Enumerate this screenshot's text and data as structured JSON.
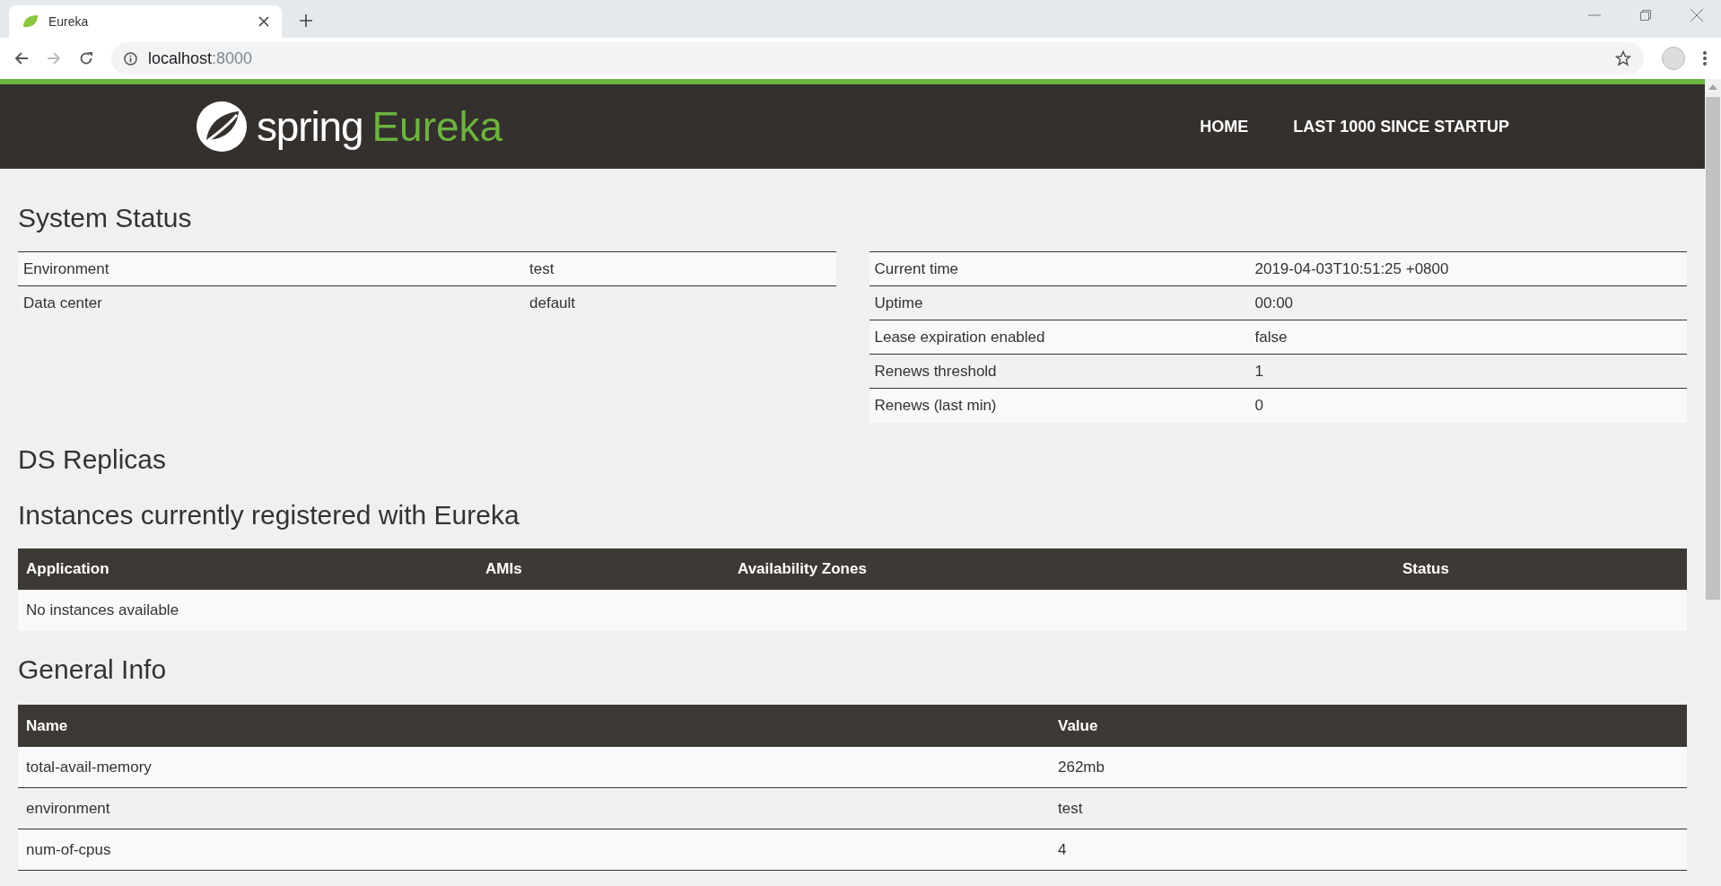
{
  "browser": {
    "tab_title": "Eureka",
    "url_host": "localhost",
    "url_port": ":8000"
  },
  "navbar": {
    "brand_word": "spring",
    "brand_product": "Eureka",
    "links": [
      "HOME",
      "LAST 1000 SINCE STARTUP"
    ]
  },
  "system_status": {
    "title": "System Status",
    "left": [
      {
        "label": "Environment",
        "value": "test"
      },
      {
        "label": "Data center",
        "value": "default"
      }
    ],
    "right": [
      {
        "label": "Current time",
        "value": "2019-04-03T10:51:25 +0800"
      },
      {
        "label": "Uptime",
        "value": "00:00"
      },
      {
        "label": "Lease expiration enabled",
        "value": "false"
      },
      {
        "label": "Renews threshold",
        "value": "1"
      },
      {
        "label": "Renews (last min)",
        "value": "0"
      }
    ]
  },
  "ds_replicas": {
    "title": "DS Replicas"
  },
  "instances": {
    "title": "Instances currently registered with Eureka",
    "columns": [
      "Application",
      "AMIs",
      "Availability Zones",
      "Status"
    ],
    "empty_message": "No instances available"
  },
  "general_info": {
    "title": "General Info",
    "columns": [
      "Name",
      "Value"
    ],
    "rows": [
      {
        "name": "total-avail-memory",
        "value": "262mb"
      },
      {
        "name": "environment",
        "value": "test"
      },
      {
        "name": "num-of-cpus",
        "value": "4"
      }
    ]
  }
}
